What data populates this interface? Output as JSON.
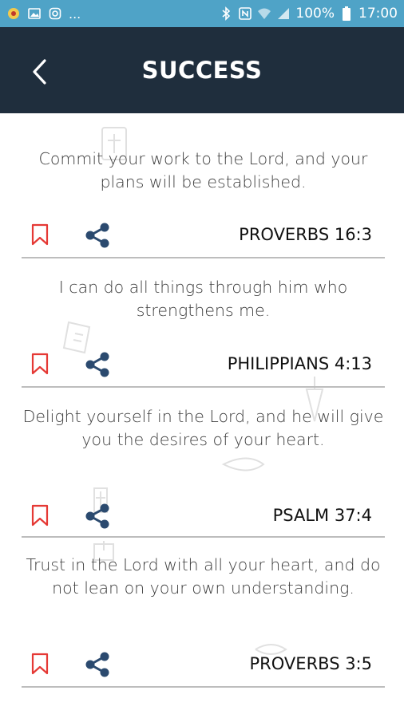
{
  "status_bar": {
    "left_more": "...",
    "battery_text": "100%",
    "time": "17:00"
  },
  "header": {
    "title": "SUCCESS"
  },
  "verses": [
    {
      "text": "Commit your work to the Lord, and your plans will be established.",
      "reference": "PROVERBS 16:3"
    },
    {
      "text": "I can do all things through him who strengthens me.",
      "reference": "PHILIPPIANS 4:13"
    },
    {
      "text": "Delight yourself in the Lord, and he will give you the desires of your heart.",
      "reference": "PSALM 37:4"
    },
    {
      "text": "Trust in the Lord with all your heart, and do not lean on your own understanding.",
      "reference": "PROVERBS 3:5"
    }
  ],
  "colors": {
    "status_bar": "#4fa3c7",
    "app_bar": "#1f2e3d",
    "bookmark": "#e53935",
    "share": "#2b4a6f"
  },
  "icons": {
    "back": "chevron-left-icon",
    "bookmark": "bookmark-icon",
    "share": "share-icon"
  }
}
